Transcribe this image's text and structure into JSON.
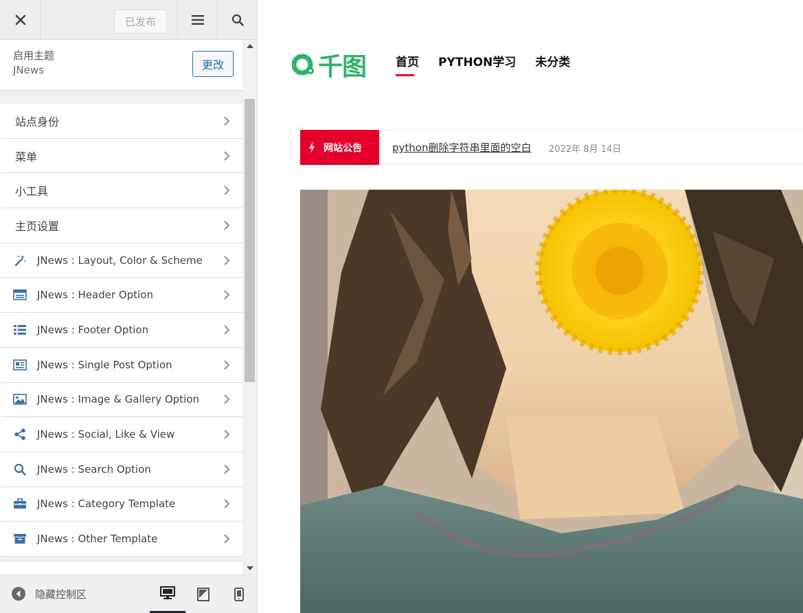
{
  "topbar": {
    "publish_label": "已发布"
  },
  "theme": {
    "section_label": "启用主题",
    "name": "JNews",
    "change_label": "更改"
  },
  "panels": [
    {
      "label": "站点身份",
      "icon": ""
    },
    {
      "label": "菜单",
      "icon": ""
    },
    {
      "label": "小工具",
      "icon": ""
    },
    {
      "label": "主页设置",
      "icon": ""
    },
    {
      "label": "JNews : Layout, Color & Scheme",
      "icon": "magic-wand-icon"
    },
    {
      "label": "JNews : Header Option",
      "icon": "header-layout-icon"
    },
    {
      "label": "JNews : Footer Option",
      "icon": "list-icon"
    },
    {
      "label": "JNews : Single Post Option",
      "icon": "newspaper-icon"
    },
    {
      "label": "JNews : Image & Gallery Option",
      "icon": "image-icon"
    },
    {
      "label": "JNews : Social, Like & View",
      "icon": "share-icon"
    },
    {
      "label": "JNews : Search Option",
      "icon": "search-icon"
    },
    {
      "label": "JNews : Category Template",
      "icon": "briefcase-icon"
    },
    {
      "label": "JNews : Other Template",
      "icon": "archive-icon"
    }
  ],
  "footer": {
    "collapse_label": "隐藏控制区"
  },
  "preview": {
    "logo_text": "千图",
    "nav": [
      "首页",
      "PYTHON学习",
      "未分类"
    ],
    "active_nav": 0,
    "ticker": {
      "badge": "网站公告",
      "headline": "python删除字符串里面的空白",
      "date": "2022年 8月 14日"
    }
  },
  "colors": {
    "accent_red": "#e4002b",
    "logo_green": "#2fb36b",
    "wp_blue": "#2271b1",
    "icon_blue": "#3a6fa8"
  }
}
